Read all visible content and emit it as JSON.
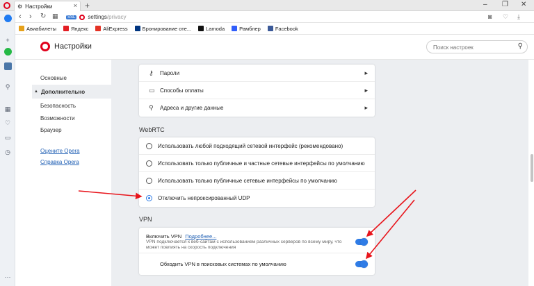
{
  "tab": {
    "title": "Настройки",
    "icon": "gear-icon"
  },
  "address": {
    "badge": "SSL",
    "url_host": "settings",
    "url_path": "/privacy"
  },
  "bookmarks": [
    {
      "label": "Авиабилеты",
      "icon": "plane-icon",
      "color": "#e6a11a"
    },
    {
      "label": "Яндекс",
      "icon": "yandex-icon",
      "color": "#e31e24"
    },
    {
      "label": "AliExpress",
      "icon": "aliexpress-icon",
      "color": "#e43225"
    },
    {
      "label": "Бронирование оте...",
      "icon": "booking-icon",
      "color": "#003580"
    },
    {
      "label": "Lamoda",
      "icon": "lamoda-icon",
      "color": "#111111"
    },
    {
      "label": "Рамблер",
      "icon": "rambler-icon",
      "color": "#315efb"
    },
    {
      "label": "Facebook",
      "icon": "facebook-icon",
      "color": "#3b5998"
    }
  ],
  "header": {
    "title": "Настройки",
    "search_placeholder": "Поиск настроек"
  },
  "nav": {
    "items": [
      "Основные",
      "Дополнительно",
      "Безопасность",
      "Возможности",
      "Браузер"
    ],
    "links": [
      "Оцените Opera",
      "Справка Opera"
    ]
  },
  "autofill": {
    "rows": [
      {
        "label": "Пароли",
        "icon": "key-icon"
      },
      {
        "label": "Способы оплаты",
        "icon": "credit-card-icon"
      },
      {
        "label": "Адреса и другие данные",
        "icon": "location-pin-icon"
      }
    ]
  },
  "webrtc": {
    "title": "WebRTC",
    "options": [
      "Использовать любой подходящий сетевой интерфейс (рекомендовано)",
      "Использовать только публичные и частные сетевые интерфейсы по умолчанию",
      "Использовать только публичные сетевые интерфейсы по умолчанию",
      "Отключить непроксированный UDP"
    ],
    "selected_index": 3
  },
  "vpn": {
    "title": "VPN",
    "enable_label": "Включить VPN",
    "more_link": "Подробнее...",
    "description": "VPN подключается к веб-сайтам с использованием различных серверов по всему миру, что может повлиять на скорость подключения",
    "enabled": true,
    "bypass_label": "Обходить VPN в поисковых системах по умолчанию",
    "bypass_enabled": true
  },
  "colors": {
    "accent": "#2f7ce6",
    "brand": "#e0001b",
    "annotation": "#e8141b"
  }
}
